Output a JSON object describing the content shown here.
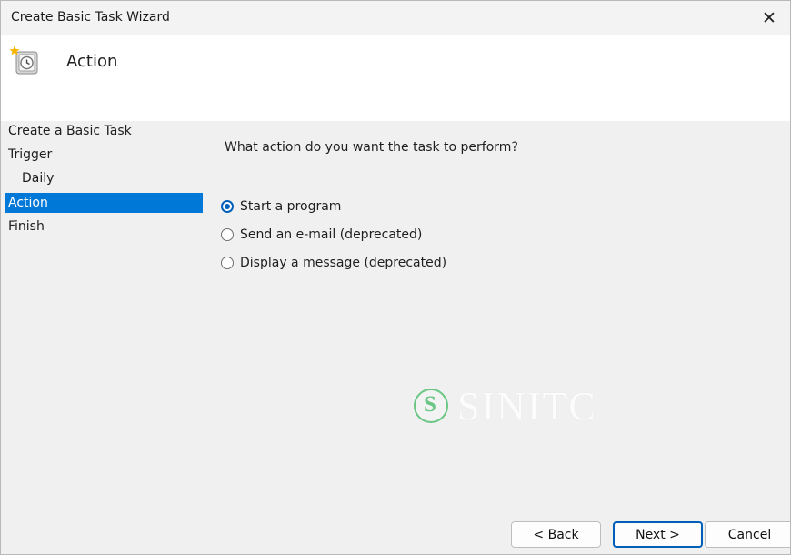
{
  "window": {
    "title": "Create Basic Task Wizard",
    "close_label": "✕"
  },
  "header": {
    "title": "Action",
    "icon": "scheduler-clock-icon"
  },
  "steps": [
    {
      "label": "Create a Basic Task",
      "selected": false
    },
    {
      "label": "Trigger",
      "selected": false
    },
    {
      "label": "Daily",
      "selected": false
    },
    {
      "label": "Action",
      "selected": true
    },
    {
      "label": "Finish",
      "selected": false
    }
  ],
  "main": {
    "question": "What action do you want the task to perform?",
    "options": [
      {
        "label": "Start a program",
        "selected": true
      },
      {
        "label": "Send an e-mail (deprecated)",
        "selected": false
      },
      {
        "label": "Display a message (deprecated)",
        "selected": false
      }
    ]
  },
  "watermark": {
    "text": "SINITC"
  },
  "buttons": {
    "back": "< Back",
    "next": "Next >",
    "cancel": "Cancel"
  }
}
